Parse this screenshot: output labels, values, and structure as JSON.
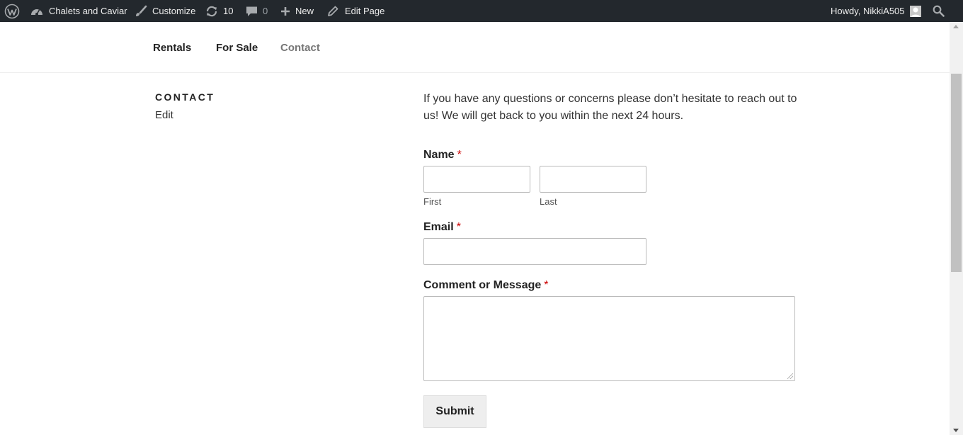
{
  "admin_bar": {
    "site_name": "Chalets and Caviar",
    "customize_label": "Customize",
    "updates_count": "10",
    "comments_count": "0",
    "new_label": "New",
    "edit_page_label": "Edit Page",
    "howdy_label": "Howdy, NikkiA505",
    "bg_color": "#23282d"
  },
  "nav": {
    "items": [
      {
        "label": "Rentals"
      },
      {
        "label": "For Sale"
      },
      {
        "label": "Contact",
        "current": true
      }
    ]
  },
  "page": {
    "title": "CONTACT",
    "edit_label": "Edit"
  },
  "form": {
    "intro_text": "If you have any questions or concerns please don’t hesitate to reach out to us! We will get back to you within the next 24 hours.",
    "required_marker": "*",
    "name_label": "Name",
    "first_sublabel": "First",
    "last_sublabel": "Last",
    "email_label": "Email",
    "message_label": "Comment or Message",
    "submit_label": "Submit",
    "first_value": "",
    "last_value": "",
    "email_value": "",
    "message_value": ""
  }
}
